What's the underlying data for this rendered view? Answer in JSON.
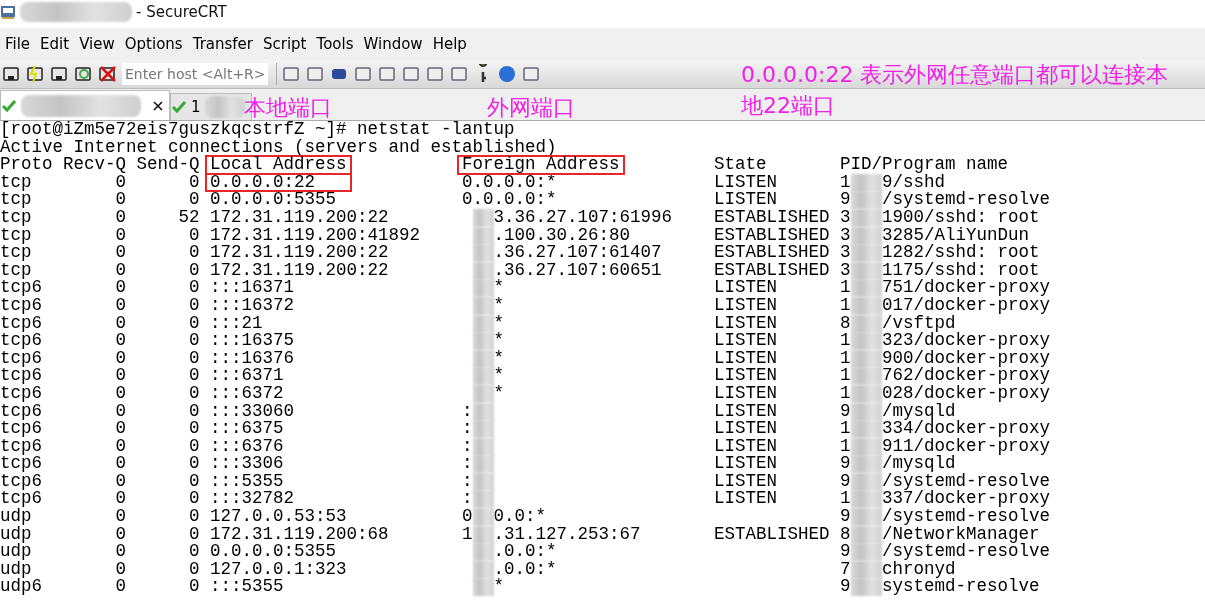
{
  "window": {
    "title": "- SecureCRT"
  },
  "menu": [
    "File",
    "Edit",
    "View",
    "Options",
    "Transfer",
    "Script",
    "Tools",
    "Window",
    "Help"
  ],
  "toolbar": {
    "host_field": {
      "placeholder": "Enter host <Alt+R>"
    }
  },
  "tabs": [
    {
      "selected": true
    },
    {
      "label": "1",
      "selected": false
    }
  ],
  "terminal": {
    "lines": [
      "[root@iZm5e72eis7guszkqcstrfZ ~]# netstat -lantup",
      "Active Internet connections (servers and established)"
    ],
    "columns": [
      {
        "label": "Proto",
        "highlighted": false
      },
      {
        "label": "Recv-Q",
        "highlighted": false
      },
      {
        "label": "Send-Q",
        "highlighted": false
      },
      {
        "label": "Local Address",
        "highlighted": true
      },
      {
        "label": "Foreign Address",
        "highlighted": true
      },
      {
        "label": "State",
        "highlighted": false
      },
      {
        "label": "PID/Program name",
        "highlighted": false
      }
    ],
    "rows": [
      {
        "proto": "tcp",
        "recv_q": "0",
        "send_q": "0",
        "local": "0.0.0.0:22",
        "local_highlighted": true,
        "foreign": {
          "head": "0.0.0.0:*",
          "masked": false
        },
        "state": "LISTEN",
        "pid": {
          "head": "1",
          "tail": "9/sshd"
        }
      },
      {
        "proto": "tcp",
        "recv_q": "0",
        "send_q": "0",
        "local": "0.0.0.0:5355",
        "local_highlighted": false,
        "foreign": {
          "head": "0.0.0.0:*",
          "masked": false
        },
        "state": "LISTEN",
        "pid": {
          "head": "9",
          "tail": "/systemd-resolve"
        }
      },
      {
        "proto": "tcp",
        "recv_q": "0",
        "send_q": "52",
        "local": "172.31.119.200:22",
        "local_highlighted": false,
        "foreign": {
          "tail": "3.36.27.107:61996",
          "masked": true
        },
        "state": "ESTABLISHED",
        "pid": {
          "head": "3",
          "tail": "1900/sshd: root"
        }
      },
      {
        "proto": "tcp",
        "recv_q": "0",
        "send_q": "0",
        "local": "172.31.119.200:41892",
        "local_highlighted": false,
        "foreign": {
          "tail": ".100.30.26:80",
          "masked": true
        },
        "state": "ESTABLISHED",
        "pid": {
          "head": "3",
          "tail": "3285/AliYunDun"
        }
      },
      {
        "proto": "tcp",
        "recv_q": "0",
        "send_q": "0",
        "local": "172.31.119.200:22",
        "local_highlighted": false,
        "foreign": {
          "tail": ".36.27.107:61407",
          "masked": true
        },
        "state": "ESTABLISHED",
        "pid": {
          "head": "3",
          "tail": "1282/sshd: root"
        }
      },
      {
        "proto": "tcp",
        "recv_q": "0",
        "send_q": "0",
        "local": "172.31.119.200:22",
        "local_highlighted": false,
        "foreign": {
          "tail": ".36.27.107:60651",
          "masked": true
        },
        "state": "ESTABLISHED",
        "pid": {
          "head": "3",
          "tail": "1175/sshd: root"
        }
      },
      {
        "proto": "tcp6",
        "recv_q": "0",
        "send_q": "0",
        "local": ":::16371",
        "local_highlighted": false,
        "foreign": {
          "tail": "*",
          "masked": true
        },
        "state": "LISTEN",
        "pid": {
          "head": "1",
          "tail": "751/docker-proxy"
        }
      },
      {
        "proto": "tcp6",
        "recv_q": "0",
        "send_q": "0",
        "local": ":::16372",
        "local_highlighted": false,
        "foreign": {
          "tail": "*",
          "masked": true
        },
        "state": "LISTEN",
        "pid": {
          "head": "1",
          "tail": "017/docker-proxy"
        }
      },
      {
        "proto": "tcp6",
        "recv_q": "0",
        "send_q": "0",
        "local": ":::21",
        "local_highlighted": false,
        "foreign": {
          "tail": "*",
          "masked": true
        },
        "state": "LISTEN",
        "pid": {
          "head": "8",
          "tail": "/vsftpd"
        }
      },
      {
        "proto": "tcp6",
        "recv_q": "0",
        "send_q": "0",
        "local": ":::16375",
        "local_highlighted": false,
        "foreign": {
          "tail": "*",
          "masked": true
        },
        "state": "LISTEN",
        "pid": {
          "head": "1",
          "tail": "323/docker-proxy"
        }
      },
      {
        "proto": "tcp6",
        "recv_q": "0",
        "send_q": "0",
        "local": ":::16376",
        "local_highlighted": false,
        "foreign": {
          "tail": "*",
          "masked": true
        },
        "state": "LISTEN",
        "pid": {
          "head": "1",
          "tail": "900/docker-proxy"
        }
      },
      {
        "proto": "tcp6",
        "recv_q": "0",
        "send_q": "0",
        "local": ":::6371",
        "local_highlighted": false,
        "foreign": {
          "tail": "*",
          "masked": true
        },
        "state": "LISTEN",
        "pid": {
          "head": "1",
          "tail": "762/docker-proxy"
        }
      },
      {
        "proto": "tcp6",
        "recv_q": "0",
        "send_q": "0",
        "local": ":::6372",
        "local_highlighted": false,
        "foreign": {
          "tail": "*",
          "masked": true
        },
        "state": "LISTEN",
        "pid": {
          "head": "1",
          "tail": "028/docker-proxy"
        }
      },
      {
        "proto": "tcp6",
        "recv_q": "0",
        "send_q": "0",
        "local": ":::33060",
        "local_highlighted": false,
        "foreign": {
          "head": ":",
          "masked": true
        },
        "state": "LISTEN",
        "pid": {
          "head": "9",
          "tail": "/mysqld"
        }
      },
      {
        "proto": "tcp6",
        "recv_q": "0",
        "send_q": "0",
        "local": ":::6375",
        "local_highlighted": false,
        "foreign": {
          "head": ":",
          "masked": true
        },
        "state": "LISTEN",
        "pid": {
          "head": "1",
          "tail": "334/docker-proxy"
        }
      },
      {
        "proto": "tcp6",
        "recv_q": "0",
        "send_q": "0",
        "local": ":::6376",
        "local_highlighted": false,
        "foreign": {
          "head": ":",
          "masked": true
        },
        "state": "LISTEN",
        "pid": {
          "head": "1",
          "tail": "911/docker-proxy"
        }
      },
      {
        "proto": "tcp6",
        "recv_q": "0",
        "send_q": "0",
        "local": ":::3306",
        "local_highlighted": false,
        "foreign": {
          "head": ":",
          "masked": true
        },
        "state": "LISTEN",
        "pid": {
          "head": "9",
          "tail": "/mysqld"
        }
      },
      {
        "proto": "tcp6",
        "recv_q": "0",
        "send_q": "0",
        "local": ":::5355",
        "local_highlighted": false,
        "foreign": {
          "head": ":",
          "masked": true
        },
        "state": "LISTEN",
        "pid": {
          "head": "9",
          "tail": "/systemd-resolve"
        }
      },
      {
        "proto": "tcp6",
        "recv_q": "0",
        "send_q": "0",
        "local": ":::32782",
        "local_highlighted": false,
        "foreign": {
          "head": ":",
          "masked": true
        },
        "state": "LISTEN",
        "pid": {
          "head": "1",
          "tail": "337/docker-proxy"
        }
      },
      {
        "proto": "udp",
        "recv_q": "0",
        "send_q": "0",
        "local": "127.0.0.53:53",
        "local_highlighted": false,
        "foreign": {
          "head": "0",
          "tail": "0.0:*",
          "masked": true
        },
        "pid": {
          "head": "9",
          "tail": "/systemd-resolve"
        }
      },
      {
        "proto": "udp",
        "recv_q": "0",
        "send_q": "0",
        "local": "172.31.119.200:68",
        "local_highlighted": false,
        "foreign": {
          "head": "1",
          "tail": ".31.127.253:67",
          "masked": true
        },
        "state": "ESTABLISHED",
        "pid": {
          "head": "8",
          "tail": "/NetworkManager"
        }
      },
      {
        "proto": "udp",
        "recv_q": "0",
        "send_q": "0",
        "local": "0.0.0.0:5355",
        "local_highlighted": false,
        "foreign": {
          "tail": ".0.0:*",
          "masked": true
        },
        "pid": {
          "head": "9",
          "tail": "/systemd-resolve"
        }
      },
      {
        "proto": "udp",
        "recv_q": "0",
        "send_q": "0",
        "local": "127.0.0.1:323",
        "local_highlighted": false,
        "foreign": {
          "tail": ".0.0:*",
          "masked": true
        },
        "pid": {
          "head": "7",
          "tail": "chronyd"
        }
      },
      {
        "proto": "udp6",
        "recv_q": "0",
        "send_q": "0",
        "local": ":::5355",
        "local_highlighted": false,
        "foreign": {
          "tail": "*",
          "masked": true
        },
        "pid": {
          "head": "9",
          "tail": "systemd-resolve"
        }
      }
    ]
  },
  "annotations": [
    "本地端口",
    "外网端口",
    "0.0.0.0:22  表示外网任意端口都可以连接本地22端口"
  ]
}
